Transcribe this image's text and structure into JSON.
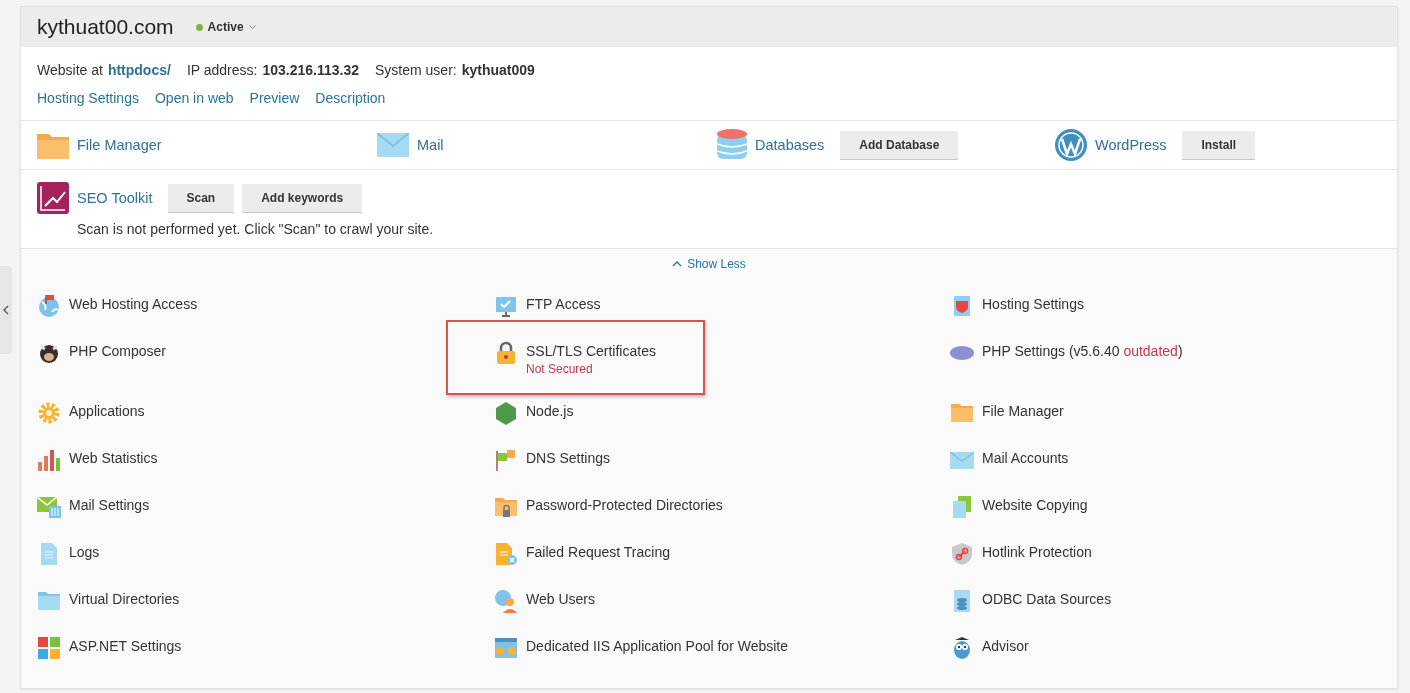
{
  "site": {
    "title": "kythuat00.com",
    "status": "Active"
  },
  "info": [
    {
      "label": "Website at",
      "value": "httpdocs/",
      "kind": "link"
    },
    {
      "label": "IP address:",
      "value": "103.216.113.32",
      "kind": "bold"
    },
    {
      "label": "System user:",
      "value": "kythuat009",
      "kind": "bold"
    }
  ],
  "links": [
    "Hosting Settings",
    "Open in web",
    "Preview",
    "Description"
  ],
  "apps": [
    {
      "label": "File Manager"
    },
    {
      "label": "Mail"
    },
    {
      "label": "Databases",
      "button": "Add Database"
    },
    {
      "label": "WordPress",
      "button": "Install"
    }
  ],
  "seo": {
    "label": "SEO Toolkit",
    "buttons": [
      "Scan",
      "Add keywords"
    ],
    "message": "Scan is not performed yet. Click \"Scan\" to crawl your site."
  },
  "toggle": {
    "label": "Show Less",
    "expanded": true
  },
  "tools": [
    {
      "label": "Web Hosting Access",
      "highlighted": false
    },
    {
      "label": "FTP Access",
      "highlighted": false
    },
    {
      "label": "Hosting Settings",
      "highlighted": false
    },
    {
      "label": "PHP Composer",
      "highlighted": false
    },
    {
      "label": "SSL/TLS Certificates",
      "status": "Not Secured",
      "highlighted": true
    },
    {
      "label": "PHP Settings (v5.6.40 ",
      "alert": "outdated",
      "suffix": ")",
      "highlighted": false
    },
    {
      "label": "Applications",
      "highlighted": false
    },
    {
      "label": "Node.js",
      "highlighted": false
    },
    {
      "label": "File Manager",
      "highlighted": false
    },
    {
      "label": "Web Statistics",
      "highlighted": false
    },
    {
      "label": "DNS Settings",
      "highlighted": false
    },
    {
      "label": "Mail Accounts",
      "highlighted": false
    },
    {
      "label": "Mail Settings",
      "highlighted": false
    },
    {
      "label": "Password-Protected Directories",
      "highlighted": false
    },
    {
      "label": "Website Copying",
      "highlighted": false
    },
    {
      "label": "Logs",
      "highlighted": false
    },
    {
      "label": "Failed Request Tracing",
      "highlighted": false
    },
    {
      "label": "Hotlink Protection",
      "highlighted": false
    },
    {
      "label": "Virtual Directories",
      "highlighted": false
    },
    {
      "label": "Web Users",
      "highlighted": false
    },
    {
      "label": "ODBC Data Sources",
      "highlighted": false
    },
    {
      "label": "ASP.NET Settings",
      "highlighted": false
    },
    {
      "label": "Dedicated IIS Application Pool for Website",
      "highlighted": false
    },
    {
      "label": "Advisor",
      "highlighted": false
    }
  ]
}
